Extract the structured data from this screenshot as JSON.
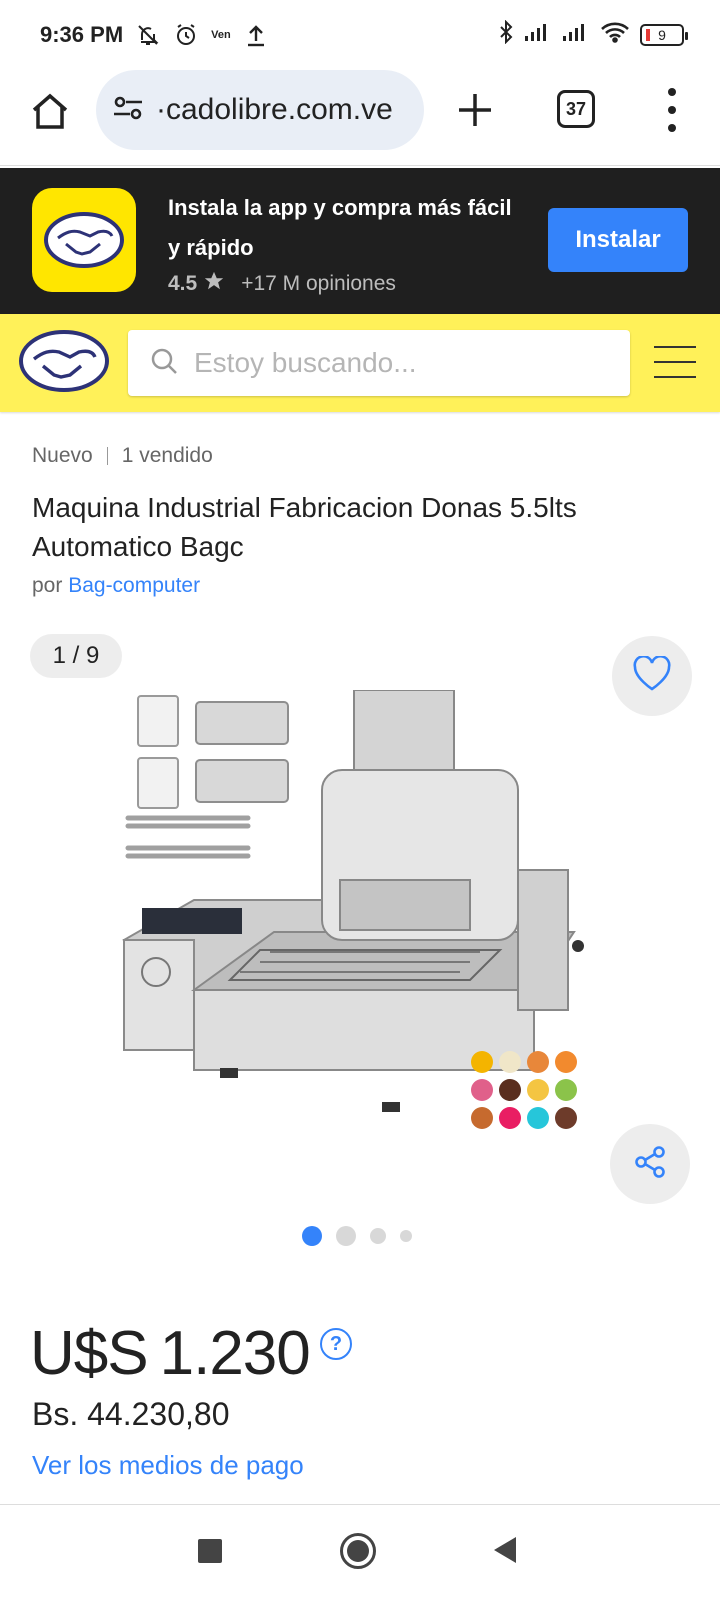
{
  "status_bar": {
    "time": "9:36 PM",
    "carrier_label": "Ven",
    "battery_level": "9",
    "icons": [
      "bell-off-icon",
      "alarm-icon",
      "upload-icon",
      "bluetooth-icon",
      "signal-icon",
      "signal-icon",
      "wifi-icon",
      "battery-icon"
    ]
  },
  "browser": {
    "url": "mercadolibre.com.ve",
    "url_visible": "·cadolibre.com.ve",
    "tab_count": "37"
  },
  "app_banner": {
    "text": "Instala la app y compra más fácil y rápido",
    "rating": "4.5",
    "reviews": "+17 M opiniones",
    "install_label": "Instalar"
  },
  "header": {
    "search_placeholder": "Estoy buscando..."
  },
  "product": {
    "condition": "Nuevo",
    "sold": "1 vendido",
    "title": "Maquina Industrial Fabricacion Donas 5.5lts Automatico Bagc",
    "seller_prefix": "por",
    "seller_name": "Bag-computer",
    "gallery_counter": "1 / 9",
    "gallery_current_index": 1,
    "gallery_total": 9,
    "price_currency": "U$S",
    "price_amount": "1.230",
    "price_bs": "Bs. 44.230,80",
    "payment_link": "Ver los medios de pago"
  },
  "colors": {
    "ml_yellow": "#fff159",
    "ml_blue": "#3483fa",
    "banner_dark": "#1f1f1f"
  }
}
